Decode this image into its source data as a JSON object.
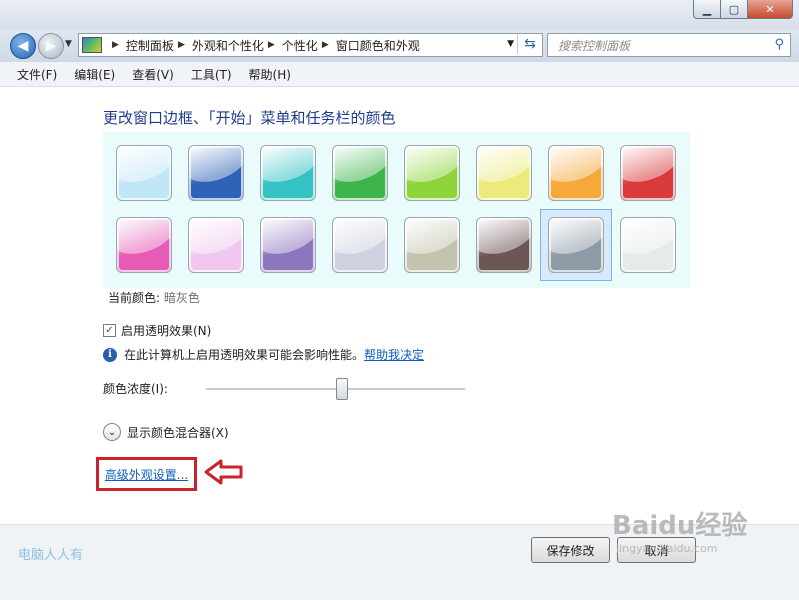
{
  "window": {
    "controls": {
      "minimize": "▁",
      "maximize": "▢",
      "close": "✕"
    }
  },
  "nav": {
    "breadcrumbs": [
      "控制面板",
      "外观和个性化",
      "个性化",
      "窗口颜色和外观"
    ],
    "search_placeholder": "搜索控制面板"
  },
  "menu": [
    "文件(F)",
    "编辑(E)",
    "查看(V)",
    "工具(T)",
    "帮助(H)"
  ],
  "main": {
    "heading": "更改窗口边框、「开始」菜单和任务栏的颜色",
    "swatches": [
      {
        "name": "sky",
        "color": "#bfe7f7"
      },
      {
        "name": "twilight",
        "color": "#2f63b8"
      },
      {
        "name": "sea",
        "color": "#35c2c3"
      },
      {
        "name": "leaf",
        "color": "#3db54a"
      },
      {
        "name": "lime",
        "color": "#8ed43d"
      },
      {
        "name": "lemon",
        "color": "#ecea7a"
      },
      {
        "name": "tangerine",
        "color": "#f4a93a"
      },
      {
        "name": "ruby",
        "color": "#d93a3a"
      },
      {
        "name": "fuchsia",
        "color": "#e55bb5"
      },
      {
        "name": "blush",
        "color": "#f0c8ef"
      },
      {
        "name": "violet",
        "color": "#8d76be"
      },
      {
        "name": "lavender",
        "color": "#cfd1e0"
      },
      {
        "name": "taupe",
        "color": "#c3c3ae"
      },
      {
        "name": "chocolate",
        "color": "#6d5756"
      },
      {
        "name": "slate",
        "color": "#8e9aa6"
      },
      {
        "name": "frost",
        "color": "#e4ece8"
      }
    ],
    "selected_index": 14,
    "current_color_label": "当前颜色:",
    "current_color_value": "暗灰色",
    "transparency_label": "启用透明效果(N)",
    "transparency_checked": true,
    "info_text": "在此计算机上启用透明效果可能会影响性能。",
    "info_link": "帮助我决定",
    "intensity_label": "颜色浓度(I):",
    "intensity_value": 0.52,
    "mixer_label": "显示颜色混合器(X)",
    "advanced_link": "高级外观设置..."
  },
  "footer": {
    "watermark": "电脑人人有",
    "save": "保存修改",
    "cancel": "取消"
  },
  "overlay": {
    "logo_text": "Baidu经验",
    "logo_url": "jingyan.baidu.com"
  },
  "colors": {
    "accent_red": "#c8232b",
    "link": "#0f5ec3",
    "heading": "#1e3d8f"
  }
}
